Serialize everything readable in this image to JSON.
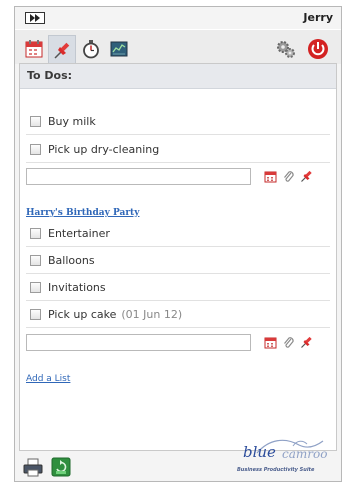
{
  "header": {
    "user_name": "Jerry"
  },
  "toolbar": {
    "tabs": [
      {
        "icon": "calendar-icon"
      },
      {
        "icon": "pushpin-icon"
      },
      {
        "icon": "stopwatch-icon"
      },
      {
        "icon": "chart-icon"
      }
    ],
    "right_icons": [
      "gears-icon",
      "power-icon"
    ]
  },
  "todos": {
    "heading": "To Dos:",
    "default_list": {
      "tasks": [
        {
          "label": "Buy milk"
        },
        {
          "label": "Pick up dry-cleaning"
        }
      ],
      "new_task_value": ""
    },
    "lists": [
      {
        "title": "Harry's Birthday Party",
        "tasks": [
          {
            "label": "Entertainer"
          },
          {
            "label": "Balloons"
          },
          {
            "label": "Invitations"
          },
          {
            "label": "Pick up cake",
            "date": "(01 Jun 12)"
          }
        ],
        "new_task_value": ""
      }
    ],
    "add_list_label": "Add a List"
  },
  "footer": {
    "logo_word_1": "blue",
    "logo_word_2": "camroo",
    "logo_tagline": "Business Productivity Suite",
    "icons": [
      "printer-icon",
      "recycle-icon"
    ]
  },
  "colors": {
    "link": "#2f67b8",
    "power_red": "#d32222",
    "logo_blue": "#2b4c9b"
  }
}
